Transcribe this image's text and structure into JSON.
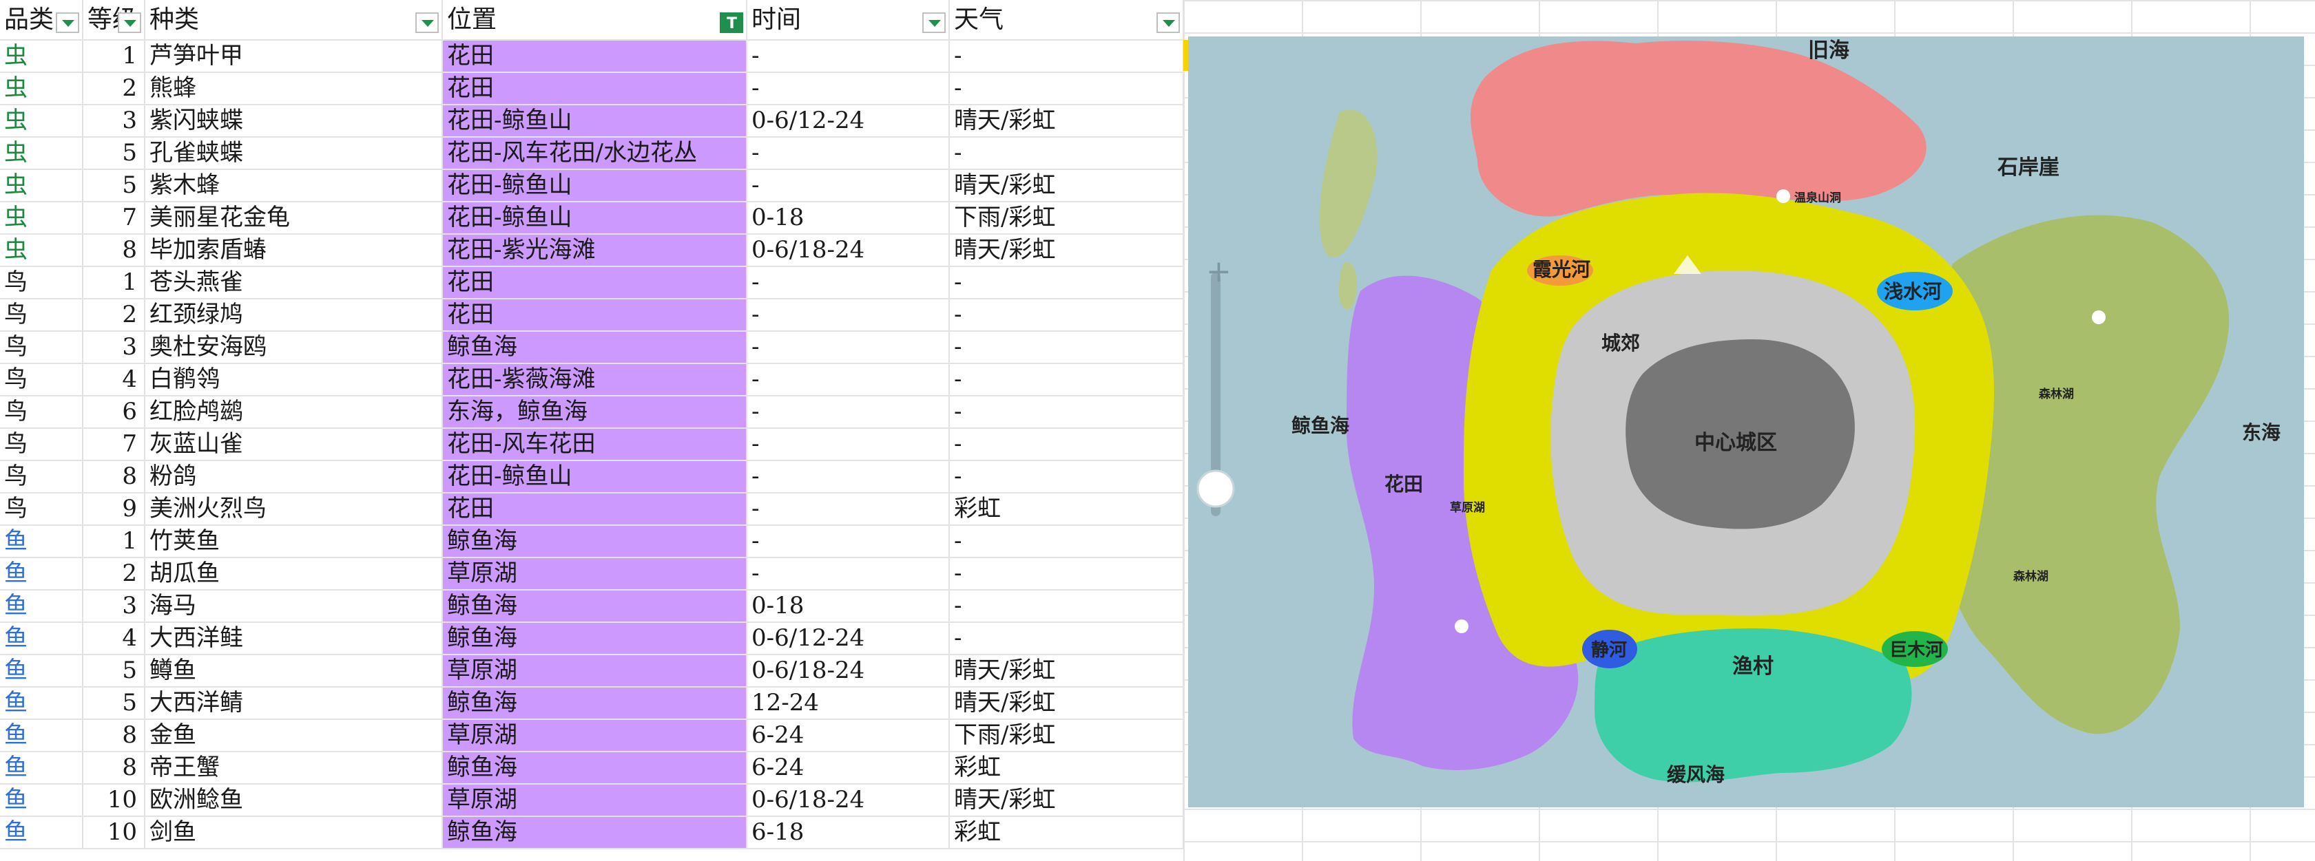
{
  "columns": [
    {
      "label": "品类",
      "filter": "dropdown"
    },
    {
      "label": "等级",
      "filter": "dropdown"
    },
    {
      "label": "种类",
      "filter": "dropdown"
    },
    {
      "label": "位置",
      "filter": "active"
    },
    {
      "label": "时间",
      "filter": "dropdown"
    },
    {
      "label": "天气",
      "filter": "dropdown"
    }
  ],
  "rows": [
    {
      "cat": "虫",
      "kind": "bug",
      "level": "1",
      "name": "芦笋叶甲",
      "loc": "花田",
      "time": "-",
      "weather": "-"
    },
    {
      "cat": "虫",
      "kind": "bug",
      "level": "2",
      "name": "熊蜂",
      "loc": "花田",
      "time": "-",
      "weather": "-"
    },
    {
      "cat": "虫",
      "kind": "bug",
      "level": "3",
      "name": "紫闪蛱蝶",
      "loc": "花田-鲸鱼山",
      "time": "0-6/12-24",
      "weather": "晴天/彩虹"
    },
    {
      "cat": "虫",
      "kind": "bug",
      "level": "5",
      "name": "孔雀蛱蝶",
      "loc": "花田-风车花田/水边花丛",
      "time": "-",
      "weather": "-"
    },
    {
      "cat": "虫",
      "kind": "bug",
      "level": "5",
      "name": "紫木蜂",
      "loc": "花田-鲸鱼山",
      "time": "-",
      "weather": "晴天/彩虹"
    },
    {
      "cat": "虫",
      "kind": "bug",
      "level": "7",
      "name": "美丽星花金龟",
      "loc": "花田-鲸鱼山",
      "time": "0-18",
      "weather": "下雨/彩虹"
    },
    {
      "cat": "虫",
      "kind": "bug",
      "level": "8",
      "name": "毕加索盾蝽",
      "loc": "花田-紫光海滩",
      "time": "0-6/18-24",
      "weather": "晴天/彩虹"
    },
    {
      "cat": "鸟",
      "kind": "bird",
      "level": "1",
      "name": "苍头燕雀",
      "loc": "花田",
      "time": "-",
      "weather": "-"
    },
    {
      "cat": "鸟",
      "kind": "bird",
      "level": "2",
      "name": "红颈绿鸠",
      "loc": "花田",
      "time": "-",
      "weather": "-"
    },
    {
      "cat": "鸟",
      "kind": "bird",
      "level": "3",
      "name": "奥杜安海鸥",
      "loc": "鲸鱼海",
      "time": "-",
      "weather": "-"
    },
    {
      "cat": "鸟",
      "kind": "bird",
      "level": "4",
      "name": "白鹡鸰",
      "loc": "花田-紫薇海滩",
      "time": "-",
      "weather": "-"
    },
    {
      "cat": "鸟",
      "kind": "bird",
      "level": "6",
      "name": "红脸鸬鹚",
      "loc": "东海，鲸鱼海",
      "time": "-",
      "weather": "-"
    },
    {
      "cat": "鸟",
      "kind": "bird",
      "level": "7",
      "name": "灰蓝山雀",
      "loc": "花田-风车花田",
      "time": "-",
      "weather": "-"
    },
    {
      "cat": "鸟",
      "kind": "bird",
      "level": "8",
      "name": "粉鸽",
      "loc": "花田-鲸鱼山",
      "time": "-",
      "weather": "-"
    },
    {
      "cat": "鸟",
      "kind": "bird",
      "level": "9",
      "name": "美洲火烈鸟",
      "loc": "花田",
      "time": "-",
      "weather": "彩虹"
    },
    {
      "cat": "鱼",
      "kind": "fish",
      "level": "1",
      "name": "竹荚鱼",
      "loc": "鲸鱼海",
      "time": "-",
      "weather": "-"
    },
    {
      "cat": "鱼",
      "kind": "fish",
      "level": "2",
      "name": "胡瓜鱼",
      "loc": "草原湖",
      "time": "-",
      "weather": "-"
    },
    {
      "cat": "鱼",
      "kind": "fish",
      "level": "3",
      "name": "海马",
      "loc": "鲸鱼海",
      "time": "0-18",
      "weather": "-"
    },
    {
      "cat": "鱼",
      "kind": "fish",
      "level": "4",
      "name": "大西洋鲑",
      "loc": "鲸鱼海",
      "time": "0-6/12-24",
      "weather": "-"
    },
    {
      "cat": "鱼",
      "kind": "fish",
      "level": "5",
      "name": "鳟鱼",
      "loc": "草原湖",
      "time": "0-6/18-24",
      "weather": "晴天/彩虹"
    },
    {
      "cat": "鱼",
      "kind": "fish",
      "level": "5",
      "name": "大西洋鲭",
      "loc": "鲸鱼海",
      "time": "12-24",
      "weather": "晴天/彩虹"
    },
    {
      "cat": "鱼",
      "kind": "fish",
      "level": "8",
      "name": "金鱼",
      "loc": "草原湖",
      "time": "6-24",
      "weather": "下雨/彩虹"
    },
    {
      "cat": "鱼",
      "kind": "fish",
      "level": "8",
      "name": "帝王蟹",
      "loc": "鲸鱼海",
      "time": "6-24",
      "weather": "彩虹"
    },
    {
      "cat": "鱼",
      "kind": "fish",
      "level": "10",
      "name": "欧洲鲶鱼",
      "loc": "草原湖",
      "time": "0-6/18-24",
      "weather": "晴天/彩虹"
    },
    {
      "cat": "鱼",
      "kind": "fish",
      "level": "10",
      "name": "剑鱼",
      "loc": "鲸鱼海",
      "time": "6-18",
      "weather": "彩虹"
    }
  ],
  "map": {
    "labels": {
      "old_sea": "旧海",
      "rock_cliff": "石岸崖",
      "hot_spring": "温泉山洞",
      "rosy_river": "霞光河",
      "shallow_river": "浅水河",
      "suburbs": "城郊",
      "whale_sea": "鲸鱼海",
      "center_city": "中心城区",
      "forest_lake_1": "森林湖",
      "east_sea": "东海",
      "flower_field": "花田",
      "grass_lake": "草原湖",
      "forest_lake_2": "森林湖",
      "quiet_river": "静河",
      "fishing_village": "渔村",
      "giant_wood_river": "巨木河",
      "gentle_wind_sea": "缓风海"
    },
    "colors": {
      "sea": "#a9c7d0",
      "red_zone": "#f08a8a",
      "yellow_zone": "#e0dd00",
      "gray_zone": "#c8c8c8",
      "purple_zone": "#b687f0",
      "teal_zone": "#3ecfa8",
      "green_land": "#a9be6a"
    }
  }
}
